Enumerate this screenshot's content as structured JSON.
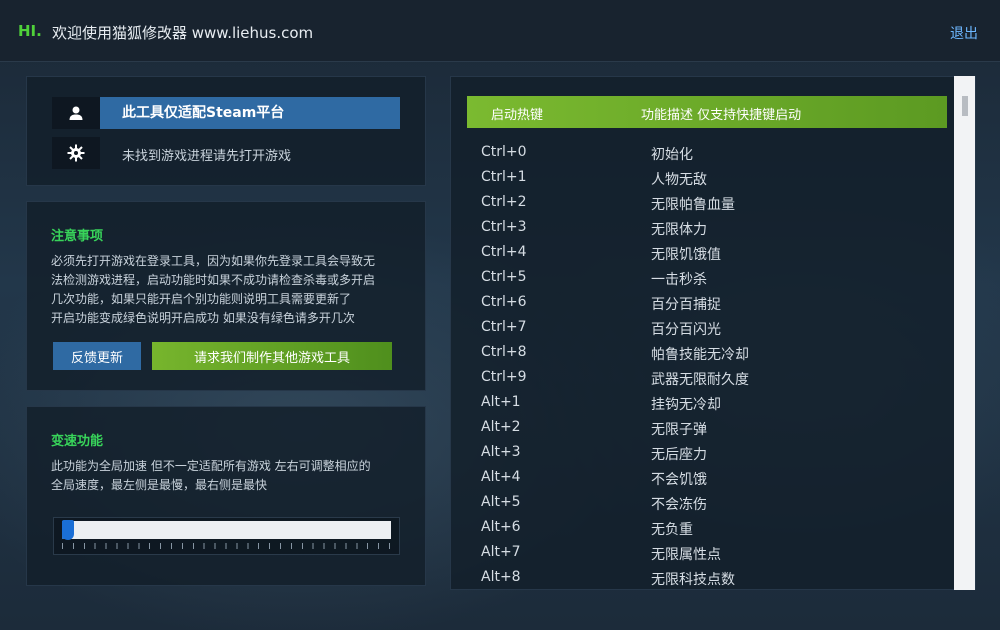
{
  "header": {
    "greeting": "HI.",
    "title": "欢迎使用猫狐修改器 www.liehus.com",
    "logout": "退出"
  },
  "status": {
    "platform_label": "此工具仅适配Steam平台",
    "process_label": "未找到游戏进程请先打开游戏"
  },
  "notice": {
    "title": "注意事项",
    "lines": [
      "必须先打开游戏在登录工具，因为如果你先登录工具会导致无",
      "法检测游戏进程，启动功能时如果不成功请检查杀毒或多开启",
      "几次功能，如果只能开启个别功能则说明工具需要更新了",
      "开启功能变成绿色说明开启成功 如果没有绿色请多开几次"
    ],
    "feedback_button": "反馈更新",
    "request_button": "请求我们制作其他游戏工具"
  },
  "speed": {
    "title": "变速功能",
    "lines": [
      "此功能为全局加速 但不一定适配所有游戏 左右可调整相应的",
      "全局速度，最左侧是最慢，最右侧是最快"
    ],
    "slider_value_fraction": 0.0
  },
  "hotkeys": {
    "col_key": "启动热键",
    "col_desc": "功能描述 仅支持快捷键启动",
    "rows": [
      {
        "key": "Ctrl+0",
        "desc": "初始化"
      },
      {
        "key": "Ctrl+1",
        "desc": "人物无敌"
      },
      {
        "key": "Ctrl+2",
        "desc": "无限帕鲁血量"
      },
      {
        "key": "Ctrl+3",
        "desc": "无限体力"
      },
      {
        "key": "Ctrl+4",
        "desc": "无限饥饿值"
      },
      {
        "key": "Ctrl+5",
        "desc": "一击秒杀"
      },
      {
        "key": "Ctrl+6",
        "desc": "百分百捕捉"
      },
      {
        "key": "Ctrl+7",
        "desc": "百分百闪光"
      },
      {
        "key": "Ctrl+8",
        "desc": "帕鲁技能无冷却"
      },
      {
        "key": "Ctrl+9",
        "desc": "武器无限耐久度"
      },
      {
        "key": "Alt+1",
        "desc": "挂钩无冷却"
      },
      {
        "key": "Alt+2",
        "desc": "无限子弹"
      },
      {
        "key": "Alt+3",
        "desc": "无后座力"
      },
      {
        "key": "Alt+4",
        "desc": "不会饥饿"
      },
      {
        "key": "Alt+5",
        "desc": "不会冻伤"
      },
      {
        "key": "Alt+6",
        "desc": "无负重"
      },
      {
        "key": "Alt+7",
        "desc": "无限属性点"
      },
      {
        "key": "Alt+8",
        "desc": "无限科技点数"
      }
    ]
  },
  "colors": {
    "accent_blue": "#2f6aa3",
    "accent_green": "#6aaa28",
    "title_green": "#38d45a",
    "link_blue": "#6db7ff"
  }
}
